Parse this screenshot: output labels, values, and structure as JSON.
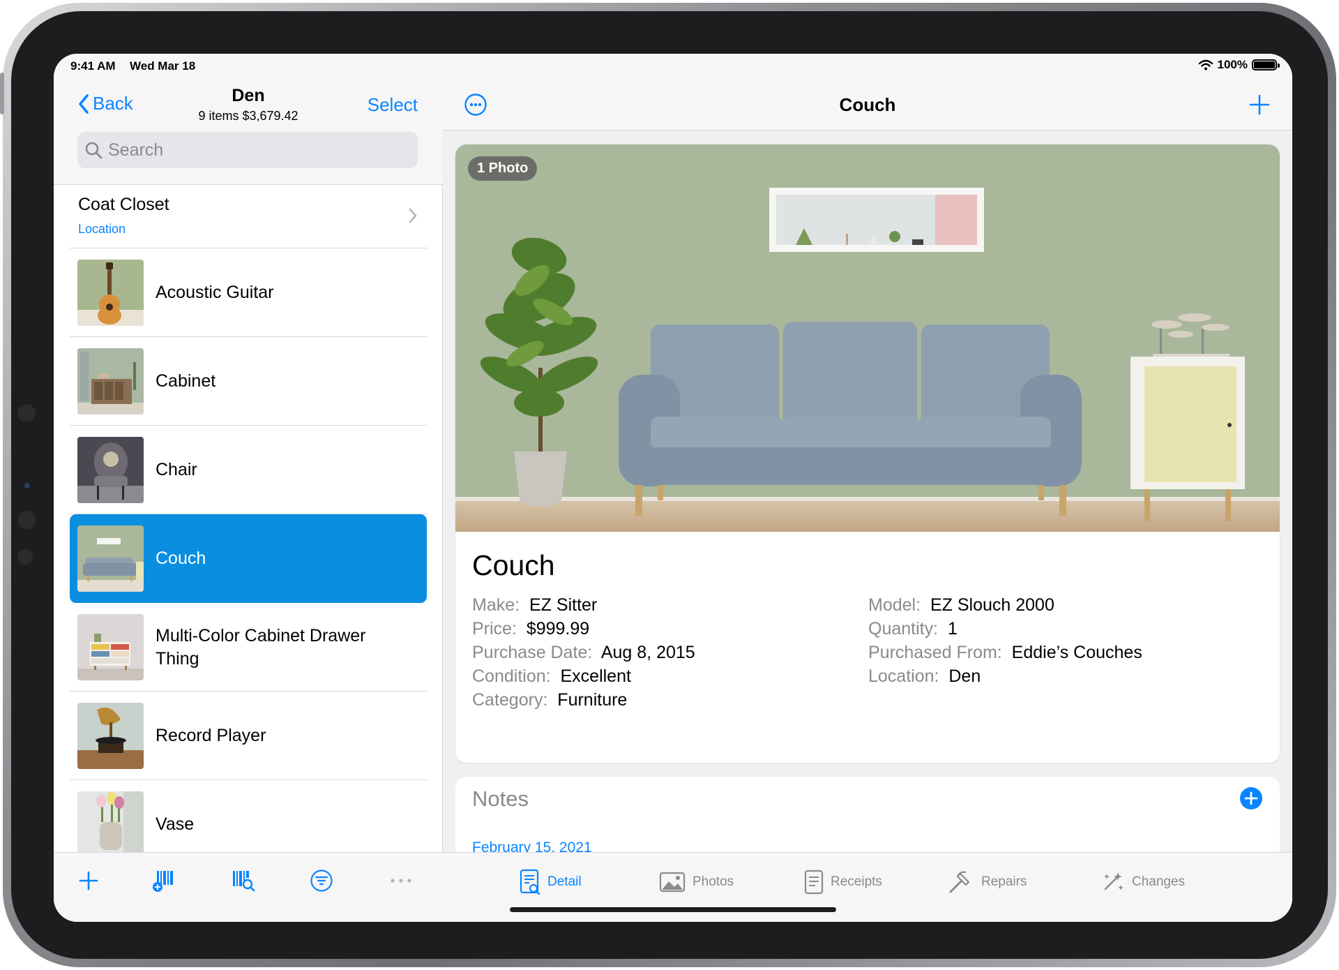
{
  "status": {
    "time": "9:41 AM",
    "date": "Wed Mar 18",
    "battery": "100%",
    "battery_level": 1.0
  },
  "sidebar": {
    "back_label": "Back",
    "title": "Den",
    "subtitle": "9 items $3,679.42",
    "select_label": "Select",
    "search_placeholder": "Search",
    "location_row": {
      "name": "Coat Closet",
      "type": "Location"
    },
    "items": [
      {
        "label": "Acoustic Guitar"
      },
      {
        "label": "Cabinet"
      },
      {
        "label": "Chair"
      },
      {
        "label": "Couch",
        "selected": true
      },
      {
        "label": "Multi-Color Cabinet Drawer Thing"
      },
      {
        "label": "Record Player"
      },
      {
        "label": "Vase"
      }
    ],
    "toolbar": [
      "plus-icon",
      "add-barcode-icon",
      "barcode-search-icon",
      "filter-icon",
      "more-icon"
    ]
  },
  "detail": {
    "title": "Couch",
    "photo_badge": "1 Photo",
    "item_name": "Couch",
    "fields_left": [
      {
        "key": "Make:",
        "value": "EZ Sitter"
      },
      {
        "key": "Price:",
        "value": "$999.99"
      },
      {
        "key": "Purchase Date:",
        "value": "Aug 8, 2015"
      },
      {
        "key": "Condition:",
        "value": "Excellent"
      },
      {
        "key": "Category:",
        "value": "Furniture"
      }
    ],
    "fields_right": [
      {
        "key": "Model:",
        "value": "EZ Slouch 2000"
      },
      {
        "key": "Quantity:",
        "value": "1"
      },
      {
        "key": "Purchased From:",
        "value": "Eddie’s Couches"
      },
      {
        "key": "Location:",
        "value": "Den"
      }
    ],
    "notes": {
      "title": "Notes",
      "date": "February 15, 2021"
    }
  },
  "tabs": [
    {
      "label": "Detail",
      "icon": "detail-icon",
      "active": true
    },
    {
      "label": "Photos",
      "icon": "photos-icon"
    },
    {
      "label": "Receipts",
      "icon": "receipts-icon"
    },
    {
      "label": "Repairs",
      "icon": "repairs-icon"
    },
    {
      "label": "Changes",
      "icon": "changes-icon"
    }
  ],
  "colors": {
    "accent": "#0a84ff",
    "selection": "#0a8ee0",
    "wall": "#a9b79a",
    "couch": "#8e9fb0"
  }
}
